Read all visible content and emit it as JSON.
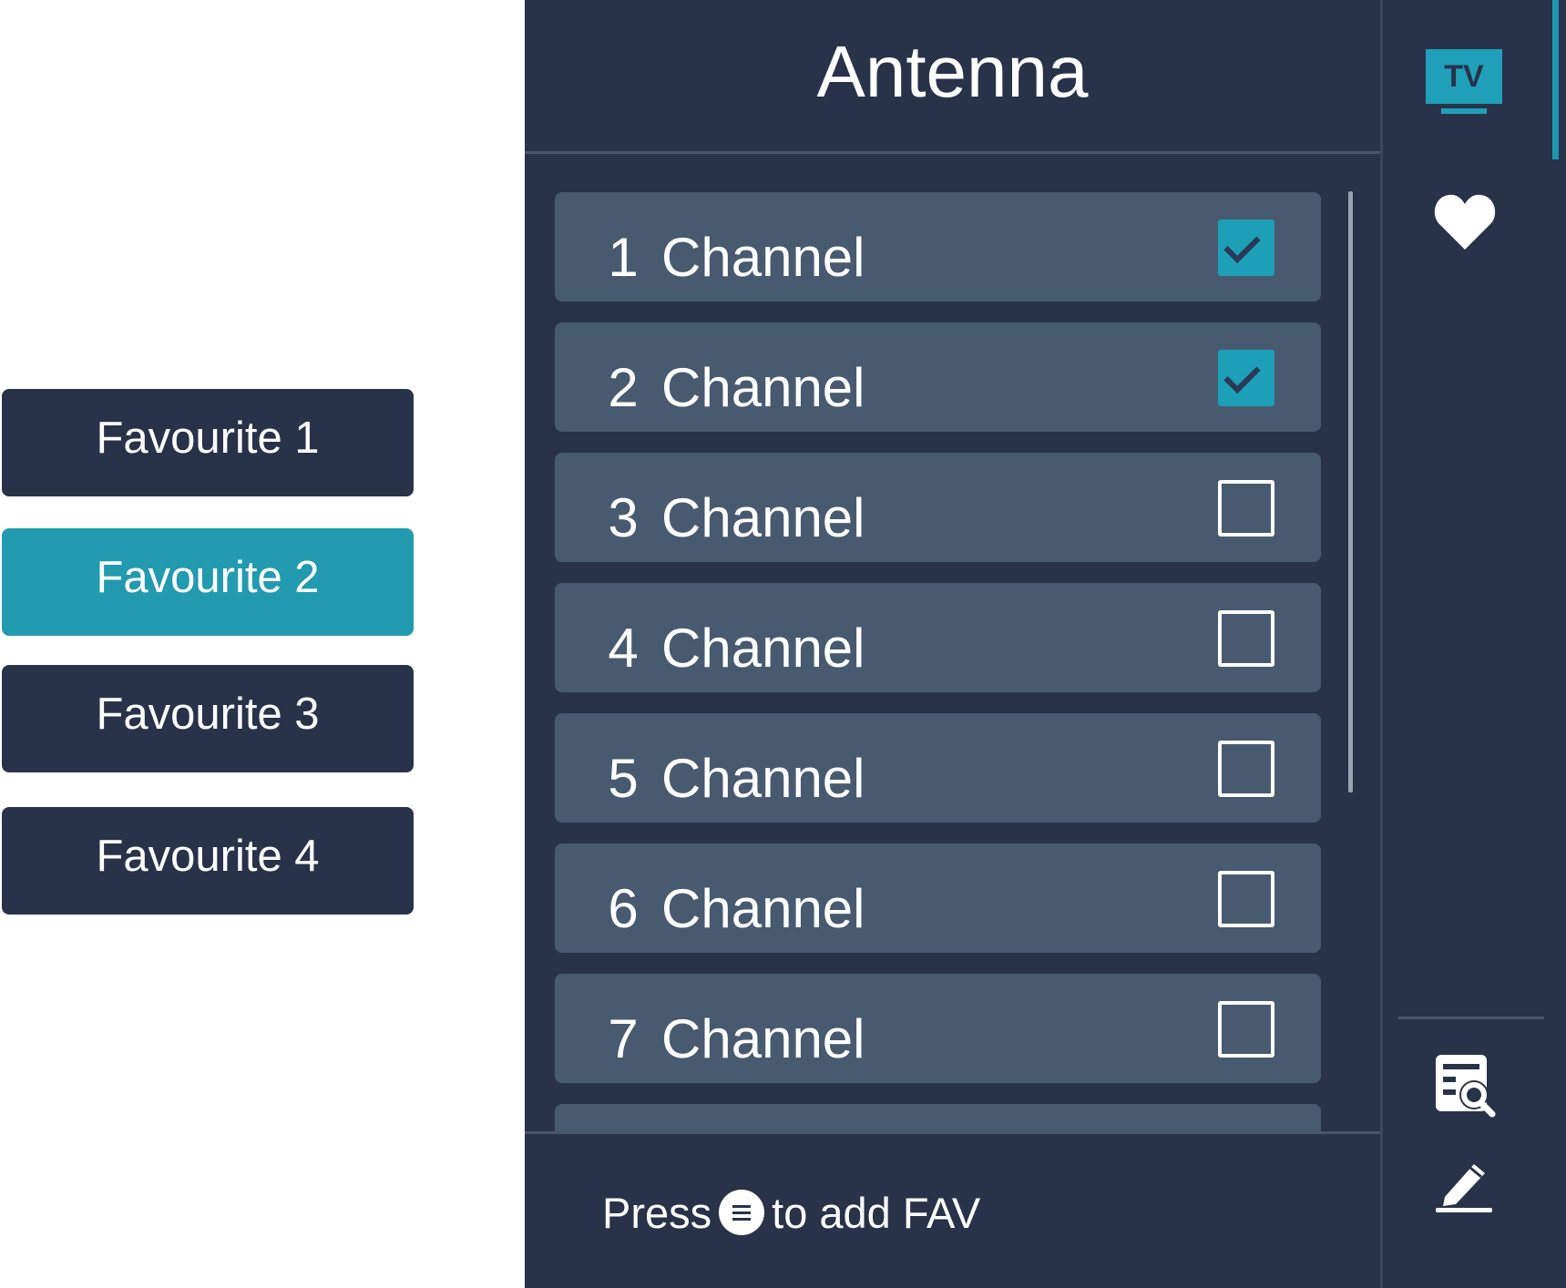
{
  "favourites": {
    "items": [
      {
        "label": "Favourite 1",
        "active": false
      },
      {
        "label": "Favourite 2",
        "active": true
      },
      {
        "label": "Favourite 3",
        "active": false
      },
      {
        "label": "Favourite 4",
        "active": false
      }
    ]
  },
  "panel": {
    "title": "Antenna",
    "channels": [
      {
        "number": "1",
        "name": "Channel",
        "checked": true
      },
      {
        "number": "2",
        "name": "Channel",
        "checked": true
      },
      {
        "number": "3",
        "name": "Channel",
        "checked": false
      },
      {
        "number": "4",
        "name": "Channel",
        "checked": false
      },
      {
        "number": "5",
        "name": "Channel",
        "checked": false
      },
      {
        "number": "6",
        "name": "Channel",
        "checked": false
      },
      {
        "number": "7",
        "name": "Channel",
        "checked": false
      },
      {
        "number": "",
        "name": "",
        "checked": false
      }
    ],
    "footer": {
      "prefix": "Press",
      "button_icon": "menu-icon",
      "suffix": "to add FAV"
    }
  },
  "rail": {
    "tv_icon_label": "TV",
    "icons": [
      "tv-icon",
      "heart-icon",
      "search-list-icon",
      "edit-icon"
    ]
  },
  "colors": {
    "background": "#28334a",
    "row": "#485a70",
    "accent": "#229aaf",
    "check": "#1d9fb8"
  }
}
